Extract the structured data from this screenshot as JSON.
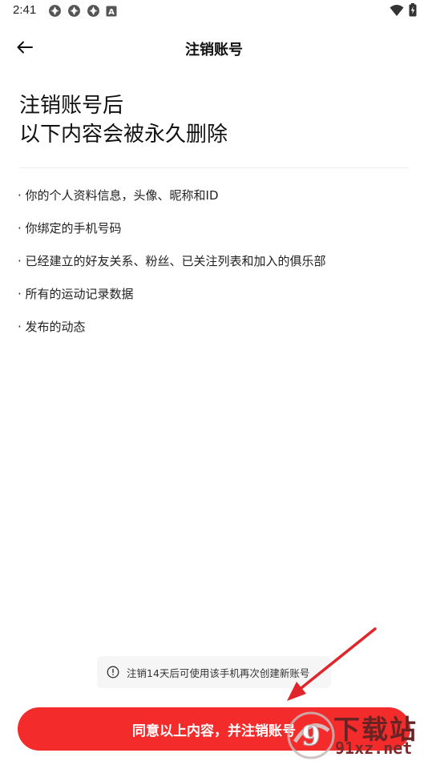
{
  "status_bar": {
    "time": "2:41",
    "left_icons": [
      "app-notification-icon",
      "app-notification-icon",
      "app-notification-icon",
      "a-letter-icon"
    ],
    "a_icon_letter": "A",
    "right_icons": [
      "wifi-icon",
      "battery-charging-icon"
    ]
  },
  "app_bar": {
    "title": "注销账号",
    "back_icon": "arrow-left-icon"
  },
  "headline": {
    "line1": "注销账号后",
    "line2": "以下内容会被永久删除"
  },
  "items": [
    "· 你的个人资料信息，头像、昵称和ID",
    "· 你绑定的手机号码",
    "· 已经建立的好友关系、粉丝、已关注列表和加入的俱乐部",
    "· 所有的运动记录数据",
    "· 发布的动态"
  ],
  "notice": {
    "icon": "info-circle-icon",
    "text": "注销14天后可使用该手机再次创建新账号"
  },
  "primary_button": {
    "label": "同意以上内容，并注销账号"
  },
  "watermark": {
    "title": "下载站",
    "domain": "91xz.net",
    "logo_text": "9"
  },
  "colors": {
    "accent": "#f42b2b",
    "annotation_arrow": "#e0262a",
    "notice_bg": "#f6f6f6",
    "divider": "#ececec",
    "watermark": "#6a2323"
  }
}
